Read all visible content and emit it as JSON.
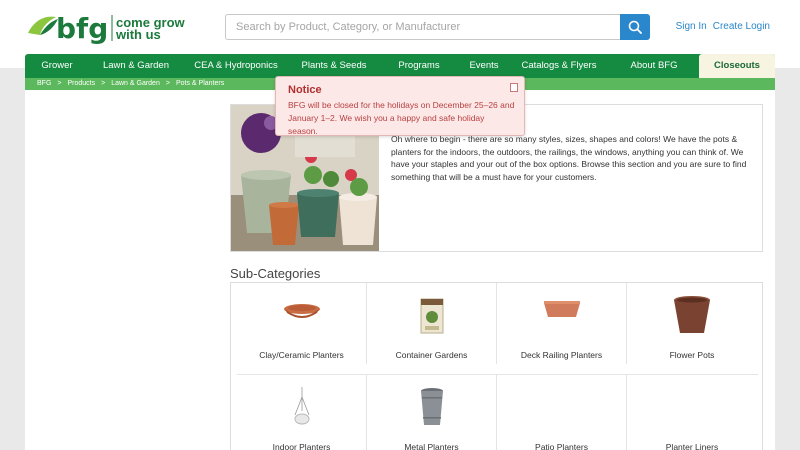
{
  "header": {
    "logo_text": "bfg",
    "tagline_line1": "come grow",
    "tagline_line2": "with us",
    "search_placeholder": "Search by Product, Category, or Manufacturer",
    "sign_in": "Sign In",
    "create_login": "Create Login"
  },
  "nav": {
    "items": [
      "Grower",
      "Lawn & Garden",
      "CEA & Hydroponics",
      "Plants & Seeds",
      "Programs",
      "Events",
      "Catalogs & Flyers",
      "About BFG",
      "Closeouts"
    ]
  },
  "breadcrumb": {
    "items": [
      "BFG",
      ">",
      "Products",
      ">",
      "Lawn & Garden",
      ">",
      "Pots & Planters"
    ]
  },
  "hero": {
    "text": "Oh where to begin - there are so many styles, sizes, shapes and colors! We have the pots & planters for the indoors, the outdoors, the railings, the windows, anything you can think of. We have your staples and your out of the box options. Browse this section and you are sure to find something that will be a must have for your customers."
  },
  "subcategories": {
    "title": "Sub-Categories",
    "items": [
      "Clay/Ceramic Planters",
      "Container Gardens",
      "Deck Railing Planters",
      "Flower Pots",
      "Indoor Planters",
      "Metal Planters",
      "Patio Planters",
      "Planter Liners"
    ]
  },
  "notice": {
    "title": "Notice",
    "body": "BFG will be closed for the holidays on December 25–26 and January 1–2. We wish you a happy and safe holiday season."
  },
  "colors": {
    "brand_green": "#158a41",
    "accent_blue": "#2b87cc",
    "notice_red": "#b03030"
  }
}
